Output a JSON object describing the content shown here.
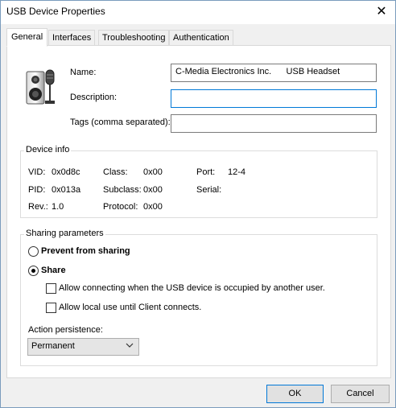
{
  "window": {
    "title": "USB Device Properties",
    "close_symbol": "✕"
  },
  "tabs": [
    {
      "label": "General"
    },
    {
      "label": "Interfaces"
    },
    {
      "label": "Troubleshooting"
    },
    {
      "label": "Authentication"
    }
  ],
  "general": {
    "icon": "usb-headset-speaker-icon",
    "name_label": "Name:",
    "name_value": "C-Media Electronics Inc.      USB Headset",
    "description_label": "Description:",
    "description_value": "",
    "tags_label": "Tags (comma separated):",
    "tags_value": ""
  },
  "device_info": {
    "title": "Device info",
    "vid_label": "VID:",
    "vid_value": "0x0d8c",
    "pid_label": "PID:",
    "pid_value": "0x013a",
    "rev_label": "Rev.:",
    "rev_value": "1.0",
    "class_label": "Class:",
    "class_value": "0x00",
    "subclass_label": "Subclass:",
    "subclass_value": "0x00",
    "protocol_label": "Protocol:",
    "protocol_value": "0x00",
    "port_label": "Port:",
    "port_value": "12-4",
    "serial_label": "Serial:",
    "serial_value": ""
  },
  "sharing": {
    "title": "Sharing parameters",
    "prevent_label": "Prevent from sharing",
    "share_label": "Share",
    "selected": "share",
    "allow_occupied_label": "Allow connecting when the USB device is occupied by another user.",
    "allow_occupied_checked": false,
    "allow_local_label": "Allow local use until Client connects.",
    "allow_local_checked": false,
    "persistence_label": "Action persistence:",
    "persistence_value": "Permanent"
  },
  "footer": {
    "ok_label": "OK",
    "cancel_label": "Cancel"
  }
}
